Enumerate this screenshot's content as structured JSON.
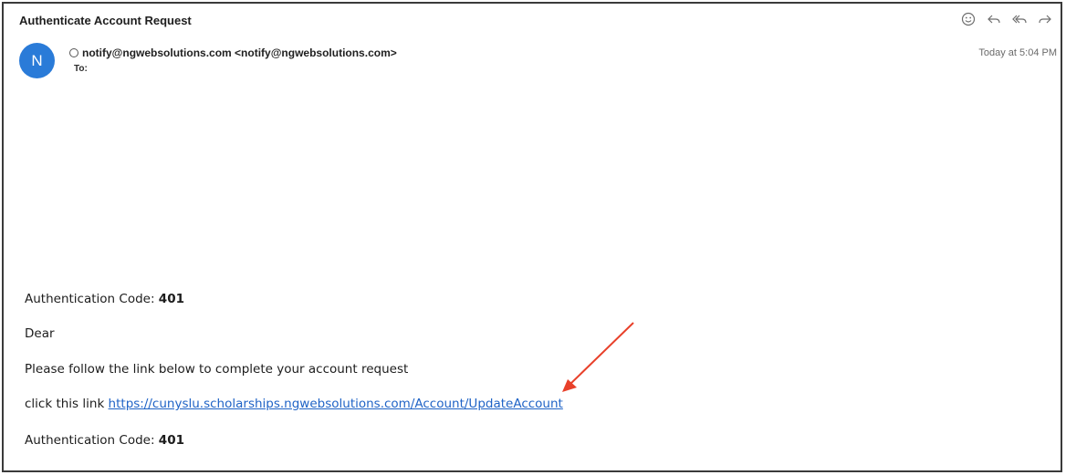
{
  "email": {
    "subject": "Authenticate Account Request",
    "avatar_initial": "N",
    "from": "notify@ngwebsolutions.com <notify@ngwebsolutions.com>",
    "to_label": "To:",
    "date": "Today at 5:04 PM"
  },
  "toolbar": {
    "icons": [
      "smiley-icon",
      "reply-icon",
      "reply-all-icon",
      "forward-icon"
    ]
  },
  "body": {
    "code_label_1": "Authentication Code: ",
    "code_value_1": "401",
    "greeting": "Dear",
    "instruction": "Please follow the link below to complete your account request",
    "link_prefix": "click this link ",
    "link_text": "https://cunyslu.scholarships.ngwebsolutions.com/Account/UpdateAccount",
    "code_label_2": "Authentication Code: ",
    "code_value_2": "401"
  },
  "colors": {
    "avatar": "#2a7bd8",
    "link": "#1f63c6",
    "annotation_arrow": "#e8402a"
  }
}
